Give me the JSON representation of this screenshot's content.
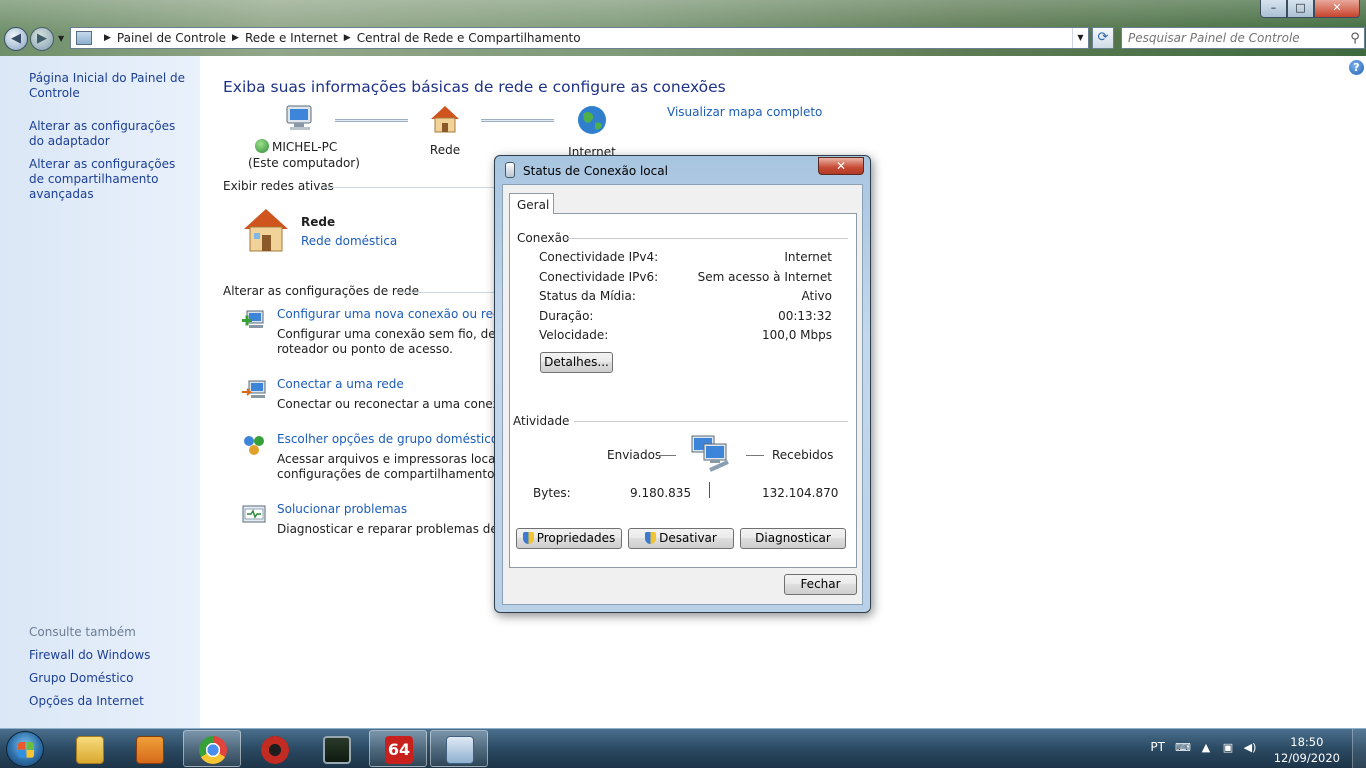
{
  "window": {
    "minimize": "–",
    "maximize": "□",
    "close": "✕"
  },
  "address_bar": {
    "breadcrumbs": [
      "Painel de Controle",
      "Rede e Internet",
      "Central de Rede e Compartilhamento"
    ],
    "search_placeholder": "Pesquisar Painel de Controle"
  },
  "sidebar": {
    "items": [
      {
        "label": "Página Inicial do Painel de Controle"
      },
      {
        "label": "Alterar as configurações do adaptador"
      },
      {
        "label": "Alterar as configurações de compartilhamento avançadas"
      }
    ],
    "see_also_title": "Consulte também",
    "see_also": [
      {
        "label": "Firewall do Windows"
      },
      {
        "label": "Grupo Doméstico"
      },
      {
        "label": "Opções da Internet"
      }
    ]
  },
  "main": {
    "heading": "Exiba suas informações básicas de rede e configure as conexões",
    "map_link": "Visualizar mapa completo",
    "nodes": {
      "computer_name": "MICHEL-PC",
      "computer_sub": "(Este computador)",
      "network": "Rede",
      "internet": "Internet"
    },
    "active_title": "Exibir redes ativas",
    "active_network_name": "Rede",
    "active_network_type": "Rede doméstica",
    "change_title": "Alterar as configurações de rede",
    "tasks": [
      {
        "link": "Configurar uma nova conexão ou rede",
        "desc1": "Configurar uma conexão sem fio, de banda larga, discada, ad hoc ou VPN; ou configurar",
        "desc2": "roteador ou ponto de acesso."
      },
      {
        "link": "Conectar a uma rede",
        "desc1": "Conectar ou reconectar a uma conexão de rede sem fio, com fio, discada ou VPN.",
        "desc2": ""
      },
      {
        "link": "Escolher opções de grupo doméstico e de compartilhamento",
        "desc1": "Acessar arquivos e impressoras localizados em outros computadores da rede ou alterar as",
        "desc2": "configurações de compartilhamento."
      },
      {
        "link": "Solucionar problemas",
        "desc1": "Diagnosticar e reparar problemas de rede ou obter informações sobre solução de problemas.",
        "desc2": ""
      }
    ]
  },
  "dialog": {
    "title": "Status de Conexão local",
    "tab": "Geral",
    "connection_title": "Conexão",
    "rows": [
      {
        "label": "Conectividade IPv4:",
        "value": "Internet"
      },
      {
        "label": "Conectividade IPv6:",
        "value": "Sem acesso à Internet"
      },
      {
        "label": "Status da Mídia:",
        "value": "Ativo"
      },
      {
        "label": "Duração:",
        "value": "00:13:32"
      },
      {
        "label": "Velocidade:",
        "value": "100,0 Mbps"
      }
    ],
    "details_button": "Detalhes...",
    "activity_title": "Atividade",
    "sent_label": "Enviados",
    "received_label": "Recebidos",
    "bytes_label": "Bytes:",
    "bytes_sent": "9.180.835",
    "bytes_received": "132.104.870",
    "properties_button": "Propriedades",
    "disable_button": "Desativar",
    "diagnose_button": "Diagnosticar",
    "close_button": "Fechar"
  },
  "taskbar": {
    "language": "PT",
    "time": "18:50",
    "date": "12/09/2020"
  },
  "colors": {
    "link": "#1c5db8",
    "heading": "#1e3287",
    "sidebar_bg": "#dbe7f6"
  }
}
